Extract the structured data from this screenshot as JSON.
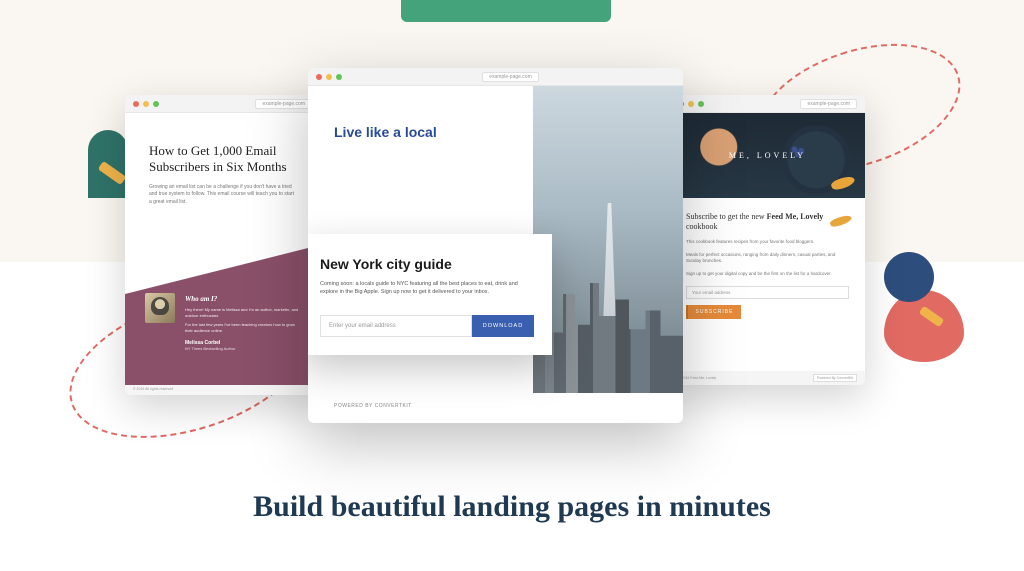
{
  "colors": {
    "green": "#44a37b",
    "navy": "#1f3a52",
    "plum": "#8a5069",
    "orange": "#e68a3a",
    "blue": "#3a5fb0"
  },
  "headline": "Build beautiful landing pages in minutes",
  "mock_left": {
    "url": "example-page.com",
    "title": "How to Get 1,000 Email Subscribers in Six Months",
    "desc": "Growing an email list can be a challenge if you don't have a tried and true system to follow. This email course will teach you to start a great email list.",
    "who_heading": "Who am I?",
    "who_p1": "Hey there! My name is Melissa and I'm an author, marketer, and outdoor enthusiast.",
    "who_p2": "For the last few years I've been teaching creators how to grow their audience online.",
    "author_name": "Melissa Corbel",
    "author_role": "NY Times Bestselling Author",
    "footer": "© 2019 All rights reserved"
  },
  "mock_right": {
    "url": "example-page.com",
    "brand": "ME, LOVELY",
    "heading_pre": "Subscribe to get the new ",
    "heading_bold": "Feed Me, Lovely",
    "heading_post": " cookbook",
    "p1": "This cookbook features recipes from your favorite food bloggers.",
    "p2": "Meals for perfect occasions, ranging from daily dinners, casual parties, and Sunday brunches.",
    "p3": "Sign up to get your digital copy and be the first on the list for a hardcover.",
    "placeholder": "Your email address",
    "button": "SUBSCRIBE",
    "footer_left": "© 2019 Feed Me, Lovely",
    "footer_right": "Powered By ConvertKit"
  },
  "mock_center": {
    "url": "example-page.com",
    "heading": "Live like a local",
    "card_title": "New York city guide",
    "card_desc": "Coming soon: a locals guide to NYC featuring all the best places to eat, drink and explore in the Big Apple. Sign up now to get it delivered to your inbox.",
    "placeholder": "Enter your email address",
    "button": "DOWNLOAD",
    "powered": "POWERED BY CONVERTKIT"
  }
}
